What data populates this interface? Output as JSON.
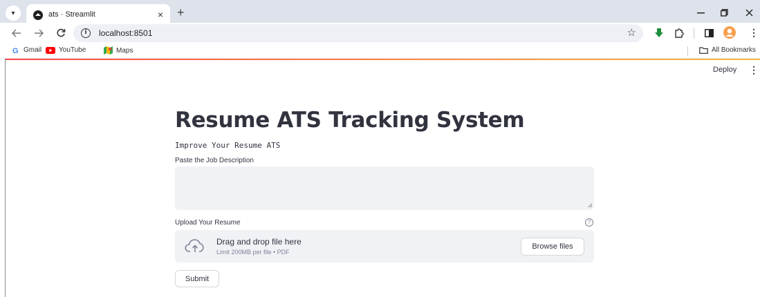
{
  "browser": {
    "tab_title": "ats · Streamlit",
    "tab_close": "×",
    "new_tab": "+",
    "url": "localhost:8501",
    "bookmarks": [
      {
        "label": "Gmail"
      },
      {
        "label": "YouTube"
      },
      {
        "label": "Maps"
      }
    ],
    "all_bookmarks": "All Bookmarks"
  },
  "app": {
    "deploy_label": "Deploy",
    "title": "Resume ATS Tracking System",
    "subtitle": "Improve Your Resume ATS",
    "job_desc_label": "Paste the Job Description",
    "job_desc_value": "",
    "upload_label": "Upload Your Resume",
    "upload_help": "?",
    "dropzone_title": "Drag and drop file here",
    "dropzone_sub": "Limit 200MB per file • PDF",
    "browse_label": "Browse files",
    "submit_label": "Submit"
  },
  "colors": {
    "text": "#31333f",
    "input_bg": "#f0f2f6",
    "tabstrip_bg": "#dee3eb",
    "accent_gradient_start": "#ff4b4b",
    "accent_gradient_end": "#ffbd45"
  }
}
